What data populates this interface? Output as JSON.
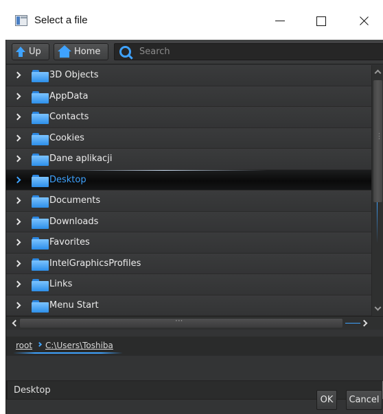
{
  "window": {
    "title": "Select a file",
    "icon": "app-window-icon",
    "controls": [
      "minimize-icon",
      "maximize-icon",
      "close-icon"
    ]
  },
  "toolbar": {
    "up_label": "Up",
    "home_label": "Home",
    "search_placeholder": "Search"
  },
  "list": {
    "items": [
      {
        "label": "3D Objects",
        "selected": false
      },
      {
        "label": "AppData",
        "selected": false
      },
      {
        "label": "Contacts",
        "selected": false
      },
      {
        "label": "Cookies",
        "selected": false
      },
      {
        "label": "Dane aplikacji",
        "selected": false
      },
      {
        "label": "Desktop",
        "selected": true
      },
      {
        "label": "Documents",
        "selected": false
      },
      {
        "label": "Downloads",
        "selected": false
      },
      {
        "label": "Favorites",
        "selected": false
      },
      {
        "label": "IntelGraphicsProfiles",
        "selected": false
      },
      {
        "label": "Links",
        "selected": false
      },
      {
        "label": "Menu Start",
        "selected": false
      }
    ]
  },
  "breadcrumb": {
    "root": "root",
    "path": "C:\\Users\\Toshiba"
  },
  "filename": {
    "value": "Desktop"
  },
  "buttons": {
    "ok": "OK",
    "cancel": "Cancel"
  },
  "colors": {
    "accent": "#3fa3ff",
    "background": "#333435",
    "selected_row": "#0a0a0a",
    "folder": "#2d8fea"
  }
}
